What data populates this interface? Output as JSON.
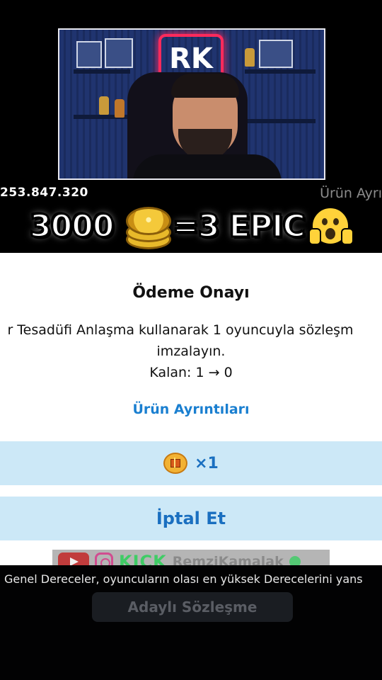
{
  "stream": {
    "viewer_count": "253.847.320",
    "ghost_text": "Ürün Ayrı",
    "webcam_logo": "RK"
  },
  "banner": {
    "amount": "3000",
    "equals_text": "=3 EPIC",
    "coin_icon": "coin-stack-icon",
    "emoji_icon": "shocked-face-icon"
  },
  "dialog": {
    "title": "Ödeme Onayı",
    "body_line1": "r Tesadüfi Anlaşma kullanarak 1 oyuncuyla sözleşm",
    "body_line2": "imzalayın.",
    "remaining": "Kalan: 1 → 0",
    "details_link": "Ürün Ayrıntıları",
    "price_icon": "gift-token-icon",
    "price_label": "×1",
    "cancel_label": "İptal Et"
  },
  "socials": {
    "platform_label": "KICK",
    "handle": "RemziKamalak",
    "icons": [
      "youtube-icon",
      "instagram-icon",
      "kick-icon",
      "verified-icon"
    ]
  },
  "footer": {
    "info_text": "Genel Dereceler, oyuncuların olası en yüksek Derecelerini yans",
    "nominee_button": "Adaylı Sözleşme"
  },
  "colors": {
    "accent_blue": "#1a6fc0",
    "button_bg": "#cce8f7",
    "kick_green": "#2bd158"
  }
}
